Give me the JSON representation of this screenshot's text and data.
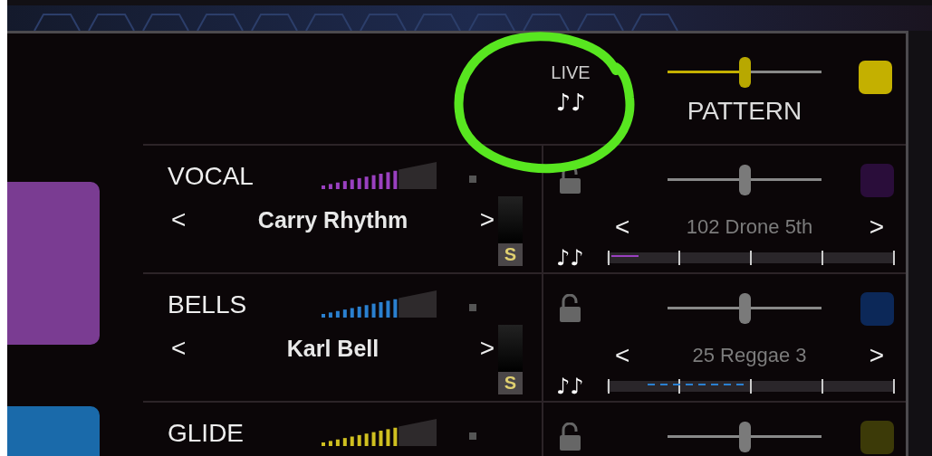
{
  "header": {
    "live": {
      "label": "LIVE",
      "notes": "♪♪"
    },
    "pattern": {
      "label": "PATTERN",
      "slider": {
        "level": 0.5
      },
      "color": "#c4b000"
    }
  },
  "tiles": [
    {
      "color": "#7a3c92"
    },
    {
      "color": "#1a6aaa"
    }
  ],
  "tracks": [
    {
      "name": "VOCAL",
      "meter": {
        "level": 0.67,
        "color": "#9a40c0"
      },
      "prev": "<",
      "preset": "Carry Rhythm",
      "next": ">",
      "solo": "S",
      "pattern_slider": {
        "level": 0.5
      },
      "color": "#2a0d3a",
      "pattern_prev": "<",
      "pattern": "102 Drone 5th",
      "pattern_next": ">",
      "notes": "♪♪",
      "timeline": {
        "kind": "solid"
      }
    },
    {
      "name": "BELLS",
      "meter": {
        "level": 0.67,
        "color": "#2a80d0"
      },
      "prev": "<",
      "preset": "Karl Bell",
      "next": ">",
      "solo": "S",
      "pattern_slider": {
        "level": 0.5
      },
      "color": "#0c2858",
      "pattern_prev": "<",
      "pattern": "25 Reggae 3",
      "pattern_next": ">",
      "notes": "♪♪",
      "timeline": {
        "kind": "dashed"
      }
    },
    {
      "name": "GLIDE",
      "meter": {
        "level": 0.67,
        "color": "#d0c020"
      },
      "pattern_slider": {
        "level": 0.5
      },
      "color": "#3c3a08"
    }
  ]
}
